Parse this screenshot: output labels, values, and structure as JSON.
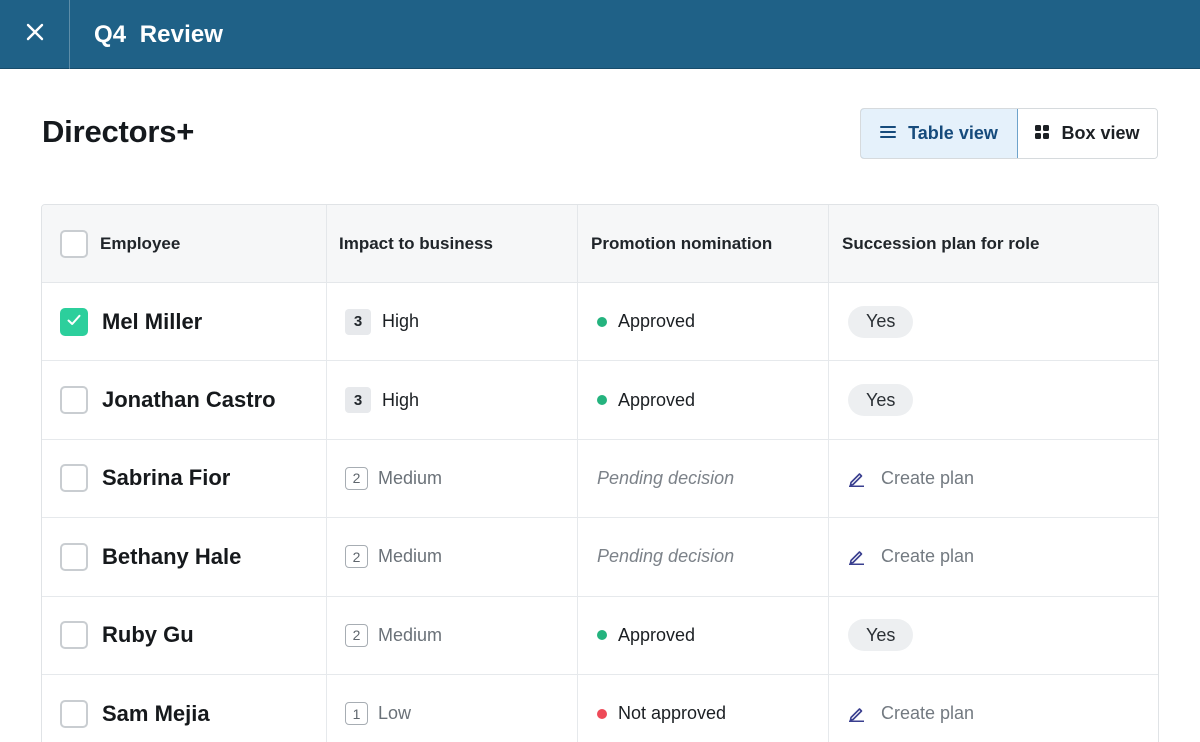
{
  "header": {
    "close_icon": "close-icon",
    "title": "Q4  Review"
  },
  "page": {
    "title": "Directors+"
  },
  "view_toggle": {
    "table_label": "Table view",
    "table_icon": "list-icon",
    "box_label": "Box view",
    "box_icon": "grid-icon",
    "selected": "table"
  },
  "table": {
    "columns": [
      "Employee",
      "Impact to business",
      "Promotion nomination",
      "Succession plan for role"
    ],
    "rows": [
      {
        "name": "Mel Miller",
        "checked": true,
        "impact_level": "3",
        "impact_label": "High",
        "promotion": "Approved",
        "promotion_status": "approved",
        "succession": "Yes",
        "succession_type": "pill"
      },
      {
        "name": "Jonathan Castro",
        "checked": false,
        "impact_level": "3",
        "impact_label": "High",
        "promotion": "Approved",
        "promotion_status": "approved",
        "succession": "Yes",
        "succession_type": "pill"
      },
      {
        "name": "Sabrina Fior",
        "checked": false,
        "impact_level": "2",
        "impact_label": "Medium",
        "promotion": "Pending decision",
        "promotion_status": "pending",
        "succession": "Create plan",
        "succession_type": "action"
      },
      {
        "name": "Bethany Hale",
        "checked": false,
        "impact_level": "2",
        "impact_label": "Medium",
        "promotion": "Pending decision",
        "promotion_status": "pending",
        "succession": "Create plan",
        "succession_type": "action"
      },
      {
        "name": "Ruby Gu",
        "checked": false,
        "impact_level": "2",
        "impact_label": "Medium",
        "promotion": "Approved",
        "promotion_status": "approved",
        "succession": "Yes",
        "succession_type": "pill"
      },
      {
        "name": "Sam Mejia",
        "checked": false,
        "impact_level": "1",
        "impact_label": "Low",
        "promotion": "Not approved",
        "promotion_status": "rejected",
        "succession": "Create plan",
        "succession_type": "action"
      }
    ]
  },
  "colors": {
    "header_bg": "#1f6187",
    "accent_selected": "#164b7c",
    "checkbox_checked": "#2ccf9c",
    "status_approved": "#24b37e",
    "status_rejected": "#ee4a58"
  }
}
